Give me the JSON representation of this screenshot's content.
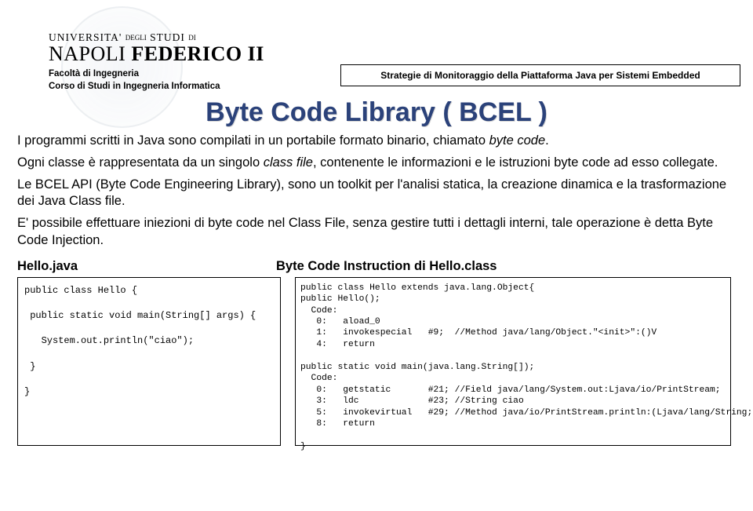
{
  "header": {
    "uni_top": "UNIVERSITA' ",
    "uni_top_small1": "DEGLI",
    "uni_top_mid": " STUDI ",
    "uni_top_small2": "DI",
    "uni_main_a": "NAPOLI",
    "uni_main_b": "FEDERICO II",
    "faculty": "Facoltà di Ingegneria",
    "course": "Corso di Studi in Ingegneria Informatica",
    "strategy": "Strategie di Monitoraggio della Piattaforma Java per Sistemi Embedded"
  },
  "title": "Byte Code Library ( BCEL )",
  "body": {
    "p1_a": "I programmi scritti in Java sono compilati in un portabile formato binario, chiamato ",
    "p1_em": "byte code",
    "p1_b": ".",
    "p2_a": "Ogni classe è rappresentata da un singolo ",
    "p2_em": "class file",
    "p2_b": ", contenente le informazioni e le istruzioni byte code ad esso collegate.",
    "p3": "Le BCEL API (Byte Code Engineering Library), sono un toolkit per l'analisi statica, la creazione dinamica e la trasformazione dei Java Class file.",
    "p4": "E' possibile effettuare iniezioni di byte code nel Class File, senza gestire tutti i dettagli interni, tale operazione è detta Byte Code Injection."
  },
  "code_captions": {
    "left": "Hello.java",
    "right": "Byte Code Instruction di Hello.class"
  },
  "code_left": "public class Hello {\n\n public static void main(String[] args) {\n\n   System.out.println(\"ciao\");\n\n }\n\n}",
  "code_right": "public class Hello extends java.lang.Object{\npublic Hello();\n  Code:\n   0:   aload_0\n   1:   invokespecial   #9;  //Method java/lang/Object.\"<init>\":()V\n   4:   return\n\npublic static void main(java.lang.String[]);\n  Code:\n   0:   getstatic       #21; //Field java/lang/System.out:Ljava/io/PrintStream;\n   3:   ldc             #23; //String ciao\n   5:   invokevirtual   #29; //Method java/io/PrintStream.println:(Ljava/lang/String;)V\n   8:   return\n\n}"
}
